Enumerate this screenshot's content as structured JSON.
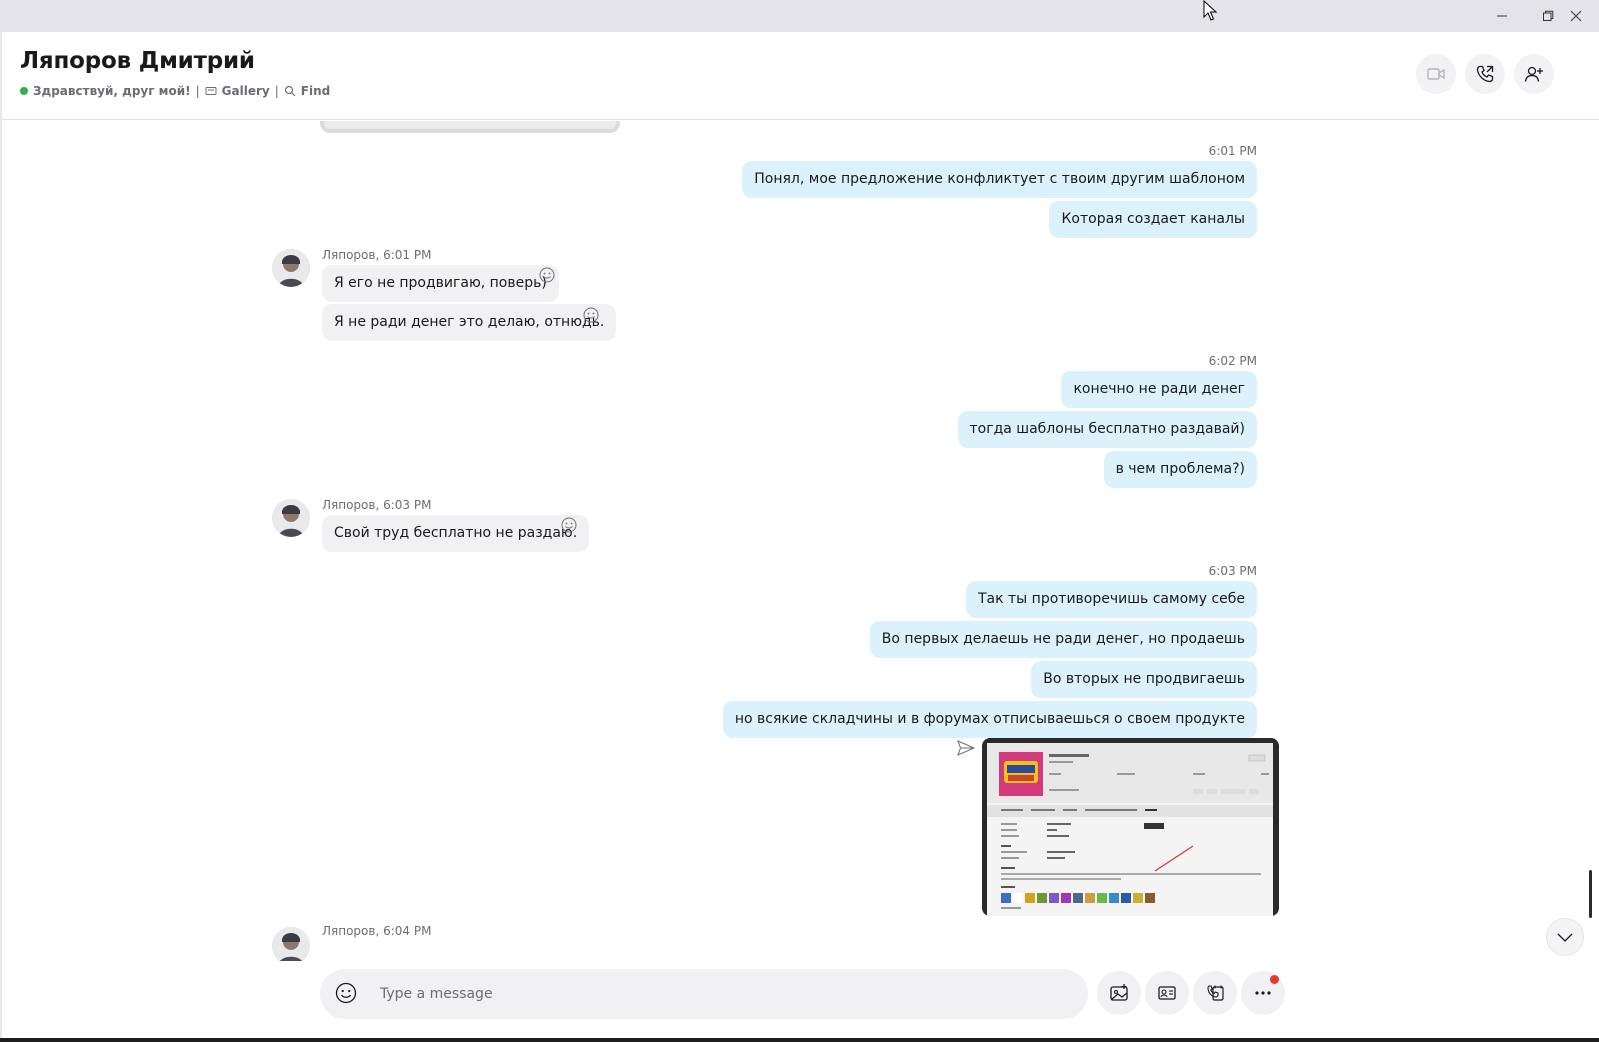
{
  "window": {
    "controls": [
      "minimize",
      "restore",
      "close"
    ]
  },
  "header": {
    "contact_name": "Ляпоров Дмитрий",
    "status_text": "Здравствуй, друг мой!",
    "separator": "|",
    "gallery_label": "Gallery",
    "find_label": "Find",
    "online_color": "#2fb34a",
    "buttons": [
      "video-call",
      "audio-call",
      "add-people"
    ]
  },
  "messages": {
    "out_group_1": {
      "time": "6:01 PM",
      "lines": [
        "Понял, мое предложение конфликтует с твоим другим шаблоном",
        "Которая создает каналы"
      ]
    },
    "in_group_1": {
      "sender_time": "Ляпоров, 6:01 PM",
      "lines": [
        "Я его не продвигаю, поверь)",
        "Я не ради денег это делаю, отнюдь."
      ]
    },
    "out_group_2": {
      "time": "6:02 PM",
      "lines": [
        "конечно не ради денег",
        "тогда шаблоны бесплатно раздавай)",
        "в чем проблема?)"
      ]
    },
    "in_group_2": {
      "sender_time": "Ляпоров, 6:03 PM",
      "lines": [
        "Свой труд бесплатно не раздаю."
      ]
    },
    "out_group_3": {
      "time": "6:03 PM",
      "lines": [
        "Так ты противоречишь самому себе",
        "Во первых делаешь не ради денег, но продаешь",
        "Во вторых не продвигаешь",
        "но всякие складчины и в форумах отписываешься о своем продукте"
      ],
      "attachment": "screenshot-image"
    },
    "in_group_3": {
      "sender_time": "Ляпоров, 6:04 PM"
    }
  },
  "composer": {
    "placeholder": "Type a message",
    "buttons": [
      "media",
      "contact-card",
      "schedule-call",
      "more"
    ],
    "notification_color": "#e4392f"
  },
  "colors": {
    "outgoing_bubble": "#dbf2fc",
    "incoming_bubble": "#f1f1f3"
  }
}
